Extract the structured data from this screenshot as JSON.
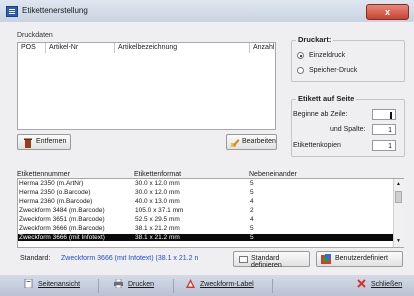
{
  "window": {
    "title": "Etikettenerstellung",
    "close_label": "x"
  },
  "print_data": {
    "group_label": "Druckdaten",
    "columns": [
      "POS",
      "Artikel-Nr",
      "Artikelbezeichnung",
      "Anzahl"
    ]
  },
  "remove_button": {
    "label": "Entfernen"
  },
  "edit_button": {
    "label": "Bearbeiten"
  },
  "print_type": {
    "title": "Druckart:",
    "options": [
      {
        "label": "Einzeldruck",
        "selected": true
      },
      {
        "label": "Speicher-Druck",
        "selected": false
      }
    ]
  },
  "label_on_page": {
    "title": "Etikett auf Seite",
    "start_row_label": "Beginne ab Zeile:",
    "start_row_value": "",
    "column_label": "und Spalte:",
    "column_value": "1",
    "copies_label": "Etikettenkopien",
    "copies_value": "1"
  },
  "label_table": {
    "columns": [
      "Etikettennummer",
      "Etikettenformat",
      "Nebeneinander"
    ],
    "rows": [
      {
        "number": "Herma 2350 (m.ArtNr)",
        "format": "30.0 x 12.0 mm",
        "side": "5",
        "selected": false
      },
      {
        "number": "Herma 2350 (o.Barcode)",
        "format": "30.0 x 12.0 mm",
        "side": "5",
        "selected": false
      },
      {
        "number": "Herma 2360 (m.Barcode)",
        "format": "40.0 x 13.0 mm",
        "side": "4",
        "selected": false
      },
      {
        "number": "Zweckform 3484 (m.Barcode)",
        "format": "105.0 x 37.1 mm",
        "side": "2",
        "selected": false
      },
      {
        "number": "Zweckform 3651 (m.Barcode)",
        "format": "52.5 x 29.5 mm",
        "side": "4",
        "selected": false
      },
      {
        "number": "Zweckform 3666 (m.Barcode)",
        "format": "38.1 x 21.2 mm",
        "side": "5",
        "selected": false
      },
      {
        "number": "Zweckform 3666 (mit Infotext)",
        "format": "38.1 x 21.2 mm",
        "side": "5",
        "selected": true
      }
    ]
  },
  "standard": {
    "label": "Standard:",
    "value": "Zweckform 3666 (mit Infotext) (38.1 x 21.2 n",
    "define_button": "Standard definieren",
    "user_button": "Benutzerdefiniert"
  },
  "footer": {
    "buttons": [
      "Seitenansicht",
      "Drucken",
      "Zweckform-Label",
      "Schließen"
    ]
  },
  "colors": {
    "link": "#1f4fd1",
    "selection": "#0a0a0a",
    "footer": "#c6cdda"
  }
}
